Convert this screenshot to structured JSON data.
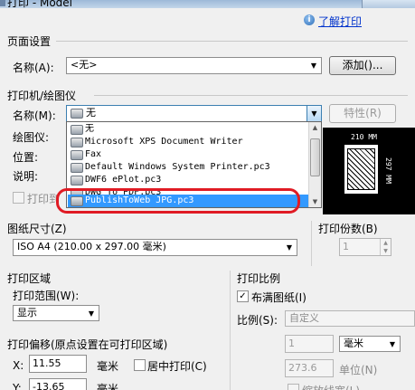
{
  "window": {
    "title": "打印 - Model"
  },
  "help": {
    "link": "了解打印"
  },
  "page_setup": {
    "section": "页面设置",
    "name_label": "名称(A):",
    "name_value": "<无>",
    "add_button": "添加()..."
  },
  "printer": {
    "section": "打印机/绘图仪",
    "name_label": "名称(M):",
    "selected_value": "无",
    "properties_button": "特性(R)",
    "plotter_label": "绘图仪:",
    "location_label": "位置:",
    "description_label": "说明:",
    "print_to_file_label": "打印到",
    "options": [
      "无",
      "Microsoft XPS Document Writer",
      "Fax",
      "Default Windows System Printer.pc3",
      "DWF6 ePlot.pc3",
      "DWG To PDF.pc3",
      "PublishToWeb JPG.pc3"
    ],
    "highlighted_option": "PublishToWeb JPG.pc3"
  },
  "preview": {
    "width_label": "210 MM",
    "height_label": "297 MM"
  },
  "paper_size": {
    "label": "图纸尺寸(Z)",
    "value": "ISO A4 (210.00 x 297.00 毫米)"
  },
  "copies": {
    "label": "打印份数(B)",
    "value": "1"
  },
  "plot_area": {
    "section": "打印区域",
    "range_label": "打印范围(W):",
    "range_value": "显示"
  },
  "plot_offset": {
    "section": "打印偏移(原点设置在可打印区域)",
    "x_label": "X:",
    "x_value": "11.55",
    "x_unit": "毫米",
    "center_label": "居中打印(C)",
    "y_label": "Y:",
    "y_value": "-13.65",
    "y_unit": "毫米"
  },
  "plot_scale": {
    "section": "打印比例",
    "fit_label": "布满图纸(I)",
    "fit_checked": true,
    "scale_label": "比例(S):",
    "scale_value": "自定义",
    "value1": "1",
    "unit_value": "毫米",
    "value2": "273.6",
    "unit_label": "单位(N)",
    "lineweights_label": "缩放线宽(L)"
  },
  "colors": {
    "selection": "#3399ff",
    "highlight_ring": "#e01b24",
    "link": "#0033cc"
  }
}
